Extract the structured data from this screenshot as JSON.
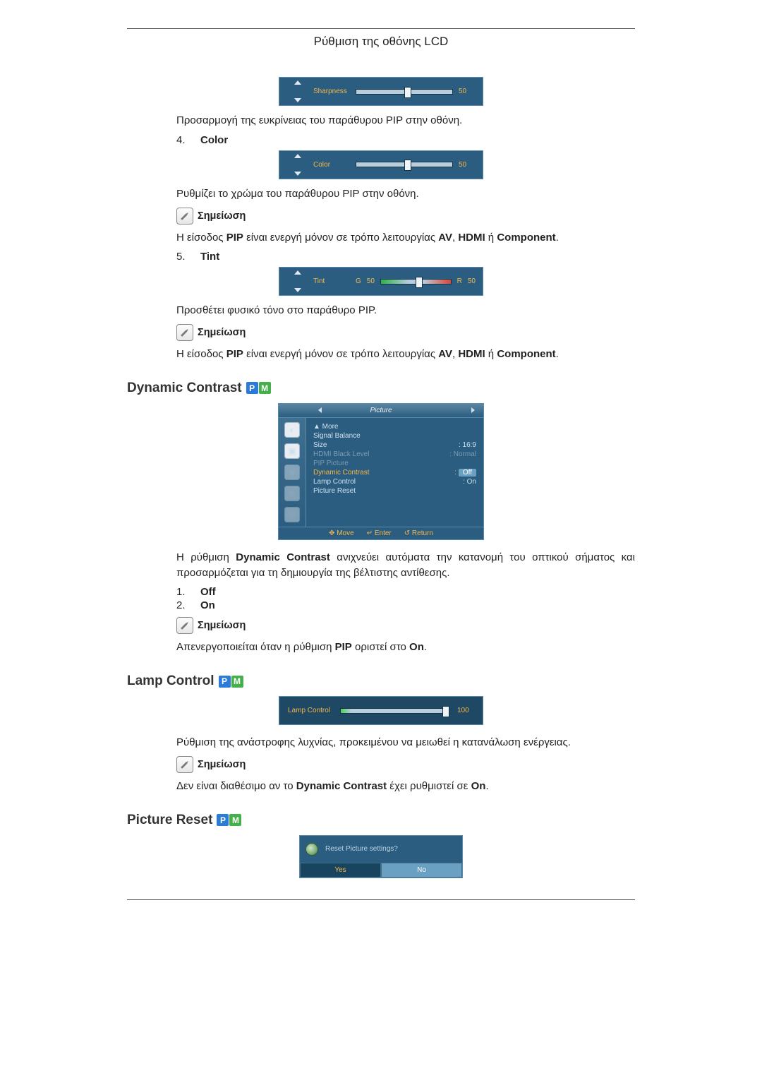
{
  "header": {
    "title": "Ρύθμιση της οθόνης LCD"
  },
  "sharpness": {
    "osd_label": "Sharpness",
    "osd_value": "50",
    "desc": "Προσαρμογή της ευκρίνειας του παράθυρου PIP στην οθόνη."
  },
  "color": {
    "num": "4.",
    "title": "Color",
    "osd_label": "Color",
    "osd_value": "50",
    "desc": "Ρυθμίζει το χρώμα του παράθυρου PIP στην οθόνη.",
    "note_label": "Σημείωση",
    "note_pre": "Η είσοδος ",
    "note_pip": "PIP",
    "note_mid": " είναι ενεργή μόνον σε τρόπο λειτουργίας ",
    "note_av": "AV",
    "note_c1": ", ",
    "note_hdmi": "HDMI",
    "note_or": " ή ",
    "note_comp": "Component",
    "note_end": "."
  },
  "tint": {
    "num": "5.",
    "title": "Tint",
    "osd_label": "Tint",
    "osd_g": "G",
    "osd_g_val": "50",
    "osd_r": "R",
    "osd_r_val": "50",
    "desc": "Προσθέτει φυσικό τόνο στο παράθυρο PIP.",
    "note_label": "Σημείωση",
    "note_pre": "Η είσοδος ",
    "note_pip": "PIP",
    "note_mid": " είναι ενεργή μόνον σε τρόπο λειτουργίας ",
    "note_av": "AV",
    "note_c1": ", ",
    "note_hdmi": "HDMI",
    "note_or": " ή ",
    "note_comp": "Component",
    "note_end": "."
  },
  "dyn": {
    "heading": "Dynamic Contrast",
    "menu_title": "Picture",
    "menu": {
      "more": "▲ More",
      "sb": "Signal Balance",
      "size": "Size",
      "size_v": ": 16:9",
      "hbl": "HDMI Black Level",
      "hbl_v": ": Normal",
      "pip": "PIP Picture",
      "dc": "Dynamic Contrast",
      "dc_v": "Off",
      "lc": "Lamp Control",
      "lc_v": ": On",
      "pr": "Picture Reset"
    },
    "foot_move": "✥ Move",
    "foot_enter": "↵ Enter",
    "foot_return": "↺ Return",
    "desc_pre": "Η ρύθμιση ",
    "desc_b": "Dynamic Contrast",
    "desc_post": " ανιχνεύει αυτόματα την κατανομή του οπτικού σήματος και προσαρμόζεται για τη δημιουργία της βέλτιστης αντίθεσης.",
    "opt1_num": "1.",
    "opt1": "Off",
    "opt2_num": "2.",
    "opt2": "On",
    "note_label": "Σημείωση",
    "note_pre": "Απενεργοποιείται όταν η ρύθμιση ",
    "note_pip": "PIP",
    "note_mid": " οριστεί στο ",
    "note_on": "On",
    "note_end": "."
  },
  "lamp": {
    "heading": "Lamp Control",
    "osd_label": "Lamp Control",
    "osd_value": "100",
    "desc": "Ρύθμιση της ανάστροφης λυχνίας, προκειμένου να μειωθεί η κατανάλωση ενέργειας.",
    "note_label": "Σημείωση",
    "note_pre": "Δεν είναι διαθέσιμο αν το ",
    "note_dc": "Dynamic Contrast",
    "note_mid": " έχει ρυθμιστεί σε ",
    "note_on": "On",
    "note_end": "."
  },
  "reset": {
    "heading": "Picture Reset",
    "dlg_text": "Reset Picture settings?",
    "btn_yes": "Yes",
    "btn_no": "No"
  }
}
